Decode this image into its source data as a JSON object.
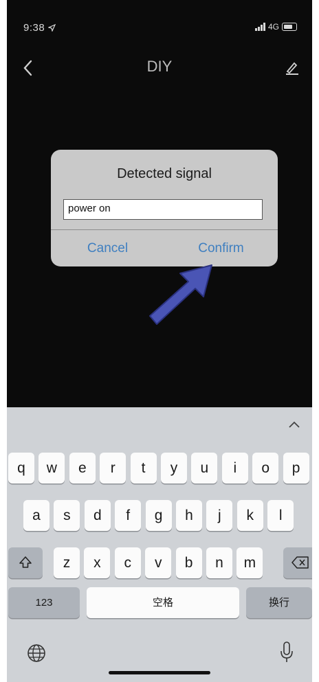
{
  "status_bar": {
    "time": "9:38",
    "network": "4G"
  },
  "nav": {
    "title": "DIY"
  },
  "dialog": {
    "title": "Detected signal",
    "input_value": "power on",
    "cancel_label": "Cancel",
    "confirm_label": "Confirm"
  },
  "keyboard": {
    "row1": [
      "q",
      "w",
      "e",
      "r",
      "t",
      "y",
      "u",
      "i",
      "o",
      "p"
    ],
    "row2": [
      "a",
      "s",
      "d",
      "f",
      "g",
      "h",
      "j",
      "k",
      "l"
    ],
    "row3": [
      "z",
      "x",
      "c",
      "v",
      "b",
      "n",
      "m"
    ],
    "numbers_label": "123",
    "space_label": "空格",
    "return_label": "换行"
  },
  "colors": {
    "accent": "#3f7fc0",
    "arrow": "#4a55b5",
    "background": "#0b0b0b",
    "keyboard_bg": "#cfd2d6"
  },
  "icons": [
    "location-arrow-icon",
    "signal-icon",
    "battery-icon",
    "back-chevron-icon",
    "edit-icon",
    "chevron-up-icon",
    "shift-icon",
    "delete-icon",
    "globe-icon",
    "mic-icon"
  ]
}
